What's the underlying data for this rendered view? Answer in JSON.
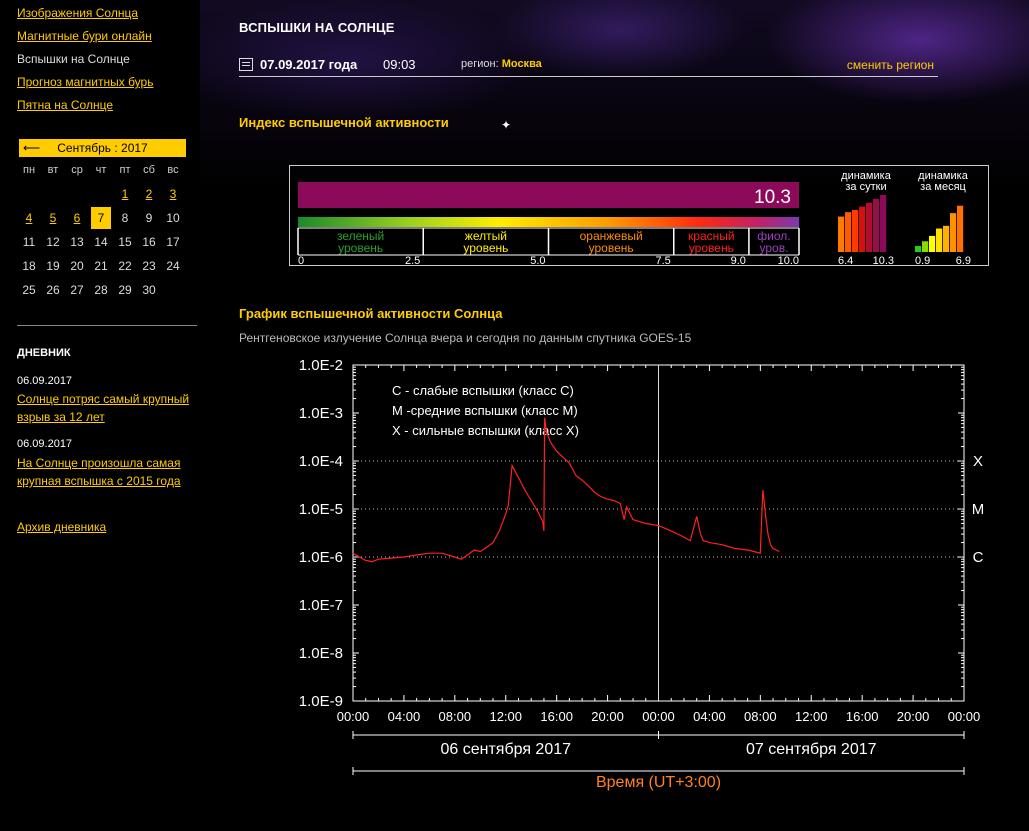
{
  "sidebar": {
    "nav": [
      {
        "label": "Изображения Солнца",
        "link": true
      },
      {
        "label": "Магнитные бури онлайн",
        "link": true
      },
      {
        "label": "Вспышки на Солнце",
        "link": false
      },
      {
        "label": "Прогноз магнитных бурь",
        "link": true
      },
      {
        "label": "Пятна на Солнце",
        "link": true
      }
    ],
    "calendar": {
      "arrow": "⟵",
      "month_label": "Сентябрь : 2017",
      "weekdays": [
        "пн",
        "вт",
        "ср",
        "чт",
        "пт",
        "сб",
        "вс"
      ],
      "weeks": [
        [
          "",
          "",
          "",
          "",
          "1",
          "2",
          "3"
        ],
        [
          "4",
          "5",
          "6",
          "7",
          "8",
          "9",
          "10"
        ],
        [
          "11",
          "12",
          "13",
          "14",
          "15",
          "16",
          "17"
        ],
        [
          "18",
          "19",
          "20",
          "21",
          "22",
          "23",
          "24"
        ],
        [
          "25",
          "26",
          "27",
          "28",
          "29",
          "30",
          ""
        ]
      ],
      "linked_days": [
        "1",
        "2",
        "3",
        "4",
        "5",
        "6"
      ],
      "today": "7"
    },
    "diary": {
      "title": "ДНЕВНИК",
      "entries": [
        {
          "date": "06.09.2017",
          "text": "Солнце потряс самый крупный взрыв за 12 лет"
        },
        {
          "date": "06.09.2017",
          "text": "На Солнце произошла самая крупная вспышка с 2015 года"
        }
      ],
      "archive_label": "Архив дневника"
    }
  },
  "header": {
    "title": "ВСПЫШКИ НА СОЛНЦЕ",
    "date": "07.09.2017 года",
    "time": "09:03",
    "region_label": "регион:",
    "region_value": "Москва",
    "change_region": "сменить регион"
  },
  "index": {
    "title": "Индекс вспышечной активности",
    "value": 10.3,
    "value_text": "10.3",
    "bar_color": "#8b0a5a",
    "scale": [
      {
        "label1": "зеленый",
        "label2": "уровень",
        "color": "#2aa02a"
      },
      {
        "label1": "желтый",
        "label2": "уровень",
        "color": "#ffee00"
      },
      {
        "label1": "оранжевый",
        "label2": "уровень",
        "color": "#ff8c00"
      },
      {
        "label1": "красный",
        "label2": "уровень",
        "color": "#ff2020"
      },
      {
        "label1": "фиол.",
        "label2": "уров.",
        "color": "#9a3fbf"
      }
    ],
    "ticks": [
      "0",
      "2.5",
      "5.0",
      "7.5",
      "9.0",
      "10.0"
    ],
    "daily": {
      "title1": "динамика",
      "title2": "за сутки",
      "values": [
        6.4,
        7.2,
        7.6,
        8.2,
        8.9,
        9.6,
        10.3
      ],
      "colors": [
        "#ff7a00",
        "#ff5a00",
        "#ff3a00",
        "#d41010",
        "#b00d30",
        "#95104a",
        "#8b0a5a"
      ],
      "min_label": "6.4",
      "max_label": "10.3"
    },
    "monthly": {
      "title1": "динамика",
      "title2": "за месяц",
      "values": [
        0.9,
        1.6,
        2.4,
        3.5,
        3.9,
        5.8,
        6.9
      ],
      "colors": [
        "#22cc22",
        "#88dd00",
        "#ffff00",
        "#ffe000",
        "#ffb000",
        "#ff9000",
        "#ff7000"
      ],
      "min_label": "0.9",
      "max_label": "6.9"
    }
  },
  "graph_section": {
    "title": "График вспышечной активности Солнца",
    "subtitle": "Рентгеновское излучение Солнца вчера и сегодня по данным спутника GOES-15"
  },
  "chart_data": {
    "type": "line",
    "y_scale": "log",
    "y_ticks": [
      "1.0E-2",
      "1.0E-3",
      "1.0E-4",
      "1.0E-5",
      "1.0E-6",
      "1.0E-7",
      "1.0E-8",
      "1.0E-9"
    ],
    "ylim": [
      1e-09,
      0.01
    ],
    "x_ticks": [
      "00:00",
      "04:00",
      "08:00",
      "12:00",
      "16:00",
      "20:00",
      "00:00",
      "04:00",
      "08:00",
      "12:00",
      "16:00",
      "20:00",
      "00:00"
    ],
    "xlim_hours": [
      0,
      48
    ],
    "day_labels": [
      "06 сентября 2017",
      "07 сентября 2017"
    ],
    "xlabel": "Время (UT+3:00)",
    "class_labels": [
      {
        "label": "X",
        "value": 0.0001
      },
      {
        "label": "M",
        "value": 1e-05
      },
      {
        "label": "C",
        "value": 1e-06
      }
    ],
    "legend": [
      "C - слабые вспышки (класс C)",
      "M -средние вспышки (класс M)",
      "X - сильные вспышки (класс X)"
    ],
    "grid": true,
    "line_color": "#ff2020",
    "series": [
      {
        "hours": [
          0,
          0.5,
          1,
          1.5,
          2,
          3,
          4,
          5,
          6,
          7,
          8,
          8.5,
          9,
          9.5,
          10,
          10.5,
          11,
          11.5,
          12,
          12.2,
          12.5,
          13,
          13.5,
          14,
          14.5,
          14.9,
          15.0,
          15.05,
          15.2,
          15.5,
          16,
          16.5,
          17,
          17.5,
          18,
          18.5,
          19,
          19.5,
          20,
          20.5,
          21,
          21.3,
          21.5,
          22,
          23,
          24,
          25,
          26,
          26.5,
          27,
          27.3,
          27.5,
          28,
          29,
          30,
          31,
          31.5,
          32,
          32.1,
          32.2,
          32.4,
          32.6,
          32.8,
          33,
          33.5
        ],
        "values": [
          1.2e-06,
          1e-06,
          8.5e-07,
          8e-07,
          9e-07,
          9.5e-07,
          1e-06,
          1.1e-06,
          1.2e-06,
          1.2e-06,
          1e-06,
          9e-07,
          1.1e-06,
          1.4e-06,
          1.3e-06,
          1.6e-06,
          2e-06,
          3.5e-06,
          8e-06,
          1.2e-05,
          8e-05,
          4.5e-05,
          2.5e-05,
          1.5e-05,
          9e-06,
          5.5e-06,
          3.5e-06,
          0.0008,
          0.0004,
          0.00025,
          0.00016,
          0.00012,
          9e-05,
          5e-05,
          4e-05,
          3e-05,
          2.2e-05,
          1.8e-05,
          1.6e-05,
          1.5e-05,
          1.3e-05,
          6e-06,
          1.1e-05,
          6e-06,
          5e-06,
          4.5e-06,
          3.5e-06,
          2.6e-06,
          2.2e-06,
          7e-06,
          3e-06,
          2.2e-06,
          2e-06,
          1.8e-06,
          1.5e-06,
          1.4e-06,
          1.3e-06,
          1.2e-06,
          6e-06,
          2.5e-05,
          8e-06,
          3e-06,
          1.8e-06,
          1.5e-06,
          1.3e-06
        ]
      }
    ]
  }
}
